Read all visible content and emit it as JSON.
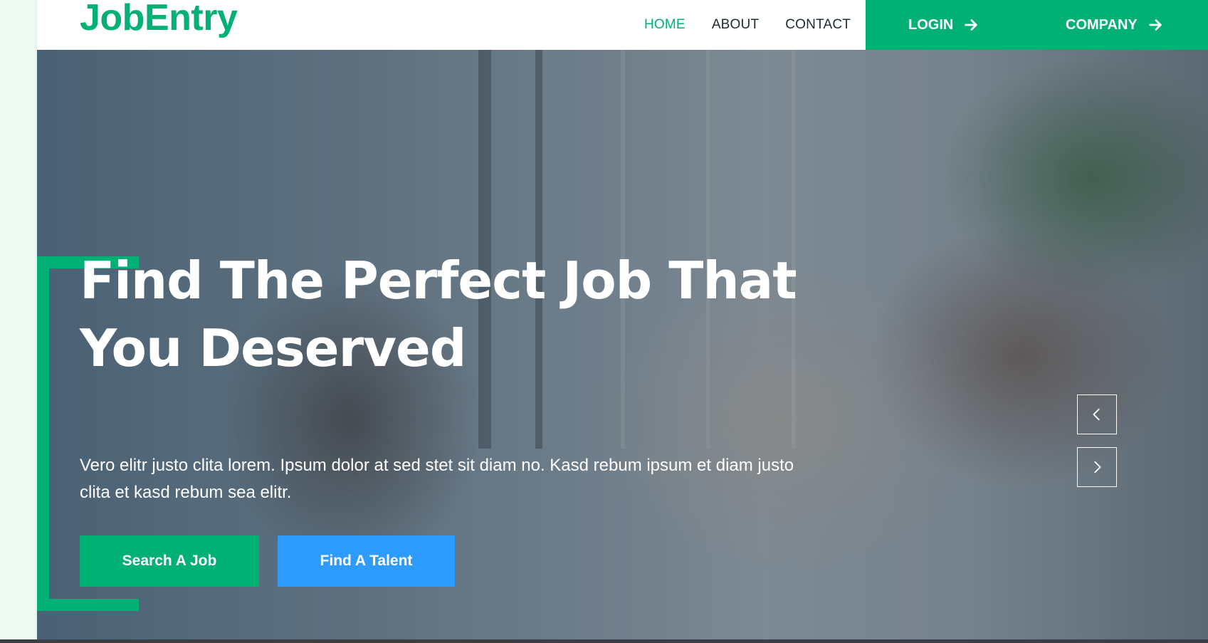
{
  "brand": {
    "name": "JobEntry",
    "color": "#00b074"
  },
  "nav": {
    "links": [
      {
        "label": "HOME",
        "active": true
      },
      {
        "label": "ABOUT",
        "active": false
      },
      {
        "label": "CONTACT",
        "active": false
      }
    ],
    "cta": [
      {
        "label": "LOGIN",
        "icon": "arrow-right-icon"
      },
      {
        "label": "COMPANY",
        "icon": "arrow-right-icon"
      }
    ]
  },
  "hero": {
    "title_line1": "Find The Perfect Job That",
    "title_line2": "You Deserved",
    "text": "Vero elitr justo clita lorem. Ipsum dolor at sed stet sit diam no. Kasd rebum ipsum et diam justo clita et kasd rebum sea elitr.",
    "buttons": {
      "search": "Search A Job",
      "talent": "Find A Talent"
    },
    "carousel": {
      "prev_icon": "chevron-left-icon",
      "next_icon": "chevron-right-icon"
    }
  },
  "colors": {
    "primary": "#00b074",
    "secondary": "#2d9bff",
    "text_dark": "#1f2a33"
  }
}
